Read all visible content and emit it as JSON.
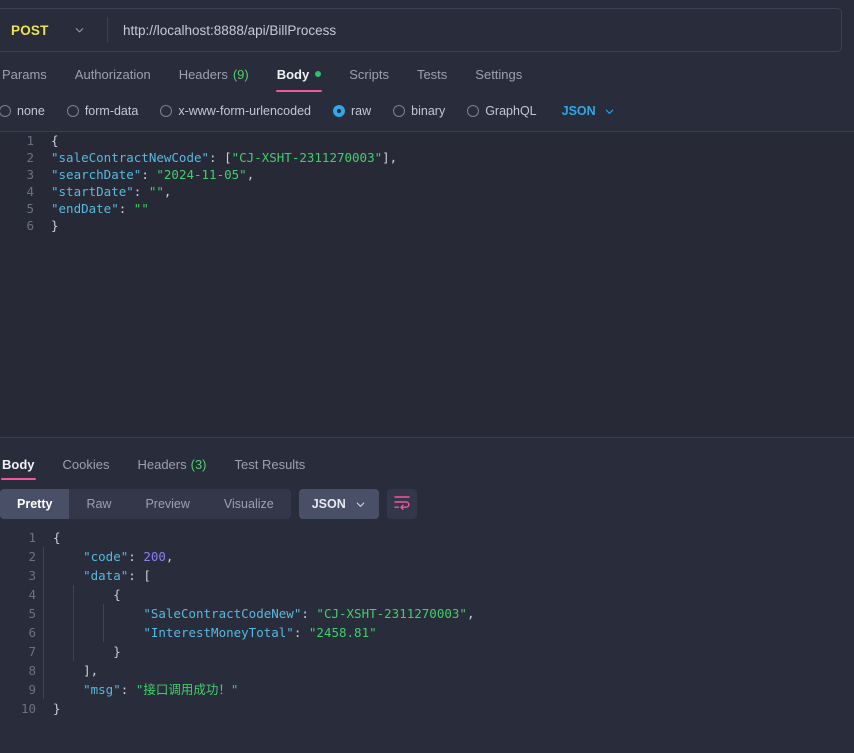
{
  "request": {
    "method": "POST",
    "method_caret_icon": "chevron-down-icon",
    "url": "http://localhost:8888/api/BillProcess",
    "tabs": [
      {
        "label": "Params",
        "active": false
      },
      {
        "label": "Authorization",
        "active": false
      },
      {
        "label": "Headers",
        "count": "(9)",
        "active": false
      },
      {
        "label": "Body",
        "active": true,
        "dot": true
      },
      {
        "label": "Scripts",
        "active": false
      },
      {
        "label": "Tests",
        "active": false
      },
      {
        "label": "Settings",
        "active": false
      }
    ],
    "body_types": [
      {
        "label": "none",
        "selected": false
      },
      {
        "label": "form-data",
        "selected": false
      },
      {
        "label": "x-www-form-urlencoded",
        "selected": false
      },
      {
        "label": "raw",
        "selected": true
      },
      {
        "label": "binary",
        "selected": false
      },
      {
        "label": "GraphQL",
        "selected": false
      }
    ],
    "format": "JSON",
    "format_caret_icon": "chevron-down-icon",
    "body_lines": [
      {
        "no": "1",
        "tokens": [
          {
            "t": "{",
            "c": "p"
          }
        ]
      },
      {
        "no": "2",
        "tokens": [
          {
            "t": "\"saleContractNewCode\"",
            "c": "k"
          },
          {
            "t": ": [",
            "c": "p"
          },
          {
            "t": "\"CJ-XSHT-2311270003\"",
            "c": "s"
          },
          {
            "t": "],",
            "c": "p"
          }
        ]
      },
      {
        "no": "3",
        "tokens": [
          {
            "t": "\"searchDate\"",
            "c": "k"
          },
          {
            "t": ": ",
            "c": "p"
          },
          {
            "t": "\"2024-11-05\"",
            "c": "s"
          },
          {
            "t": ",",
            "c": "p"
          }
        ]
      },
      {
        "no": "4",
        "tokens": [
          {
            "t": "\"startDate\"",
            "c": "k"
          },
          {
            "t": ": ",
            "c": "p"
          },
          {
            "t": "\"\"",
            "c": "s"
          },
          {
            "t": ",",
            "c": "p"
          }
        ]
      },
      {
        "no": "5",
        "tokens": [
          {
            "t": "\"endDate\"",
            "c": "k"
          },
          {
            "t": ": ",
            "c": "p"
          },
          {
            "t": "\"\"",
            "c": "s"
          }
        ]
      },
      {
        "no": "6",
        "tokens": [
          {
            "t": "}",
            "c": "p"
          }
        ]
      }
    ]
  },
  "response": {
    "tabs": [
      {
        "label": "Body",
        "active": true
      },
      {
        "label": "Cookies",
        "active": false
      },
      {
        "label": "Headers",
        "count": "(3)",
        "active": false
      },
      {
        "label": "Test Results",
        "active": false
      }
    ],
    "view_modes": [
      {
        "label": "Pretty",
        "active": true
      },
      {
        "label": "Raw",
        "active": false
      },
      {
        "label": "Preview",
        "active": false
      },
      {
        "label": "Visualize",
        "active": false
      }
    ],
    "format": "JSON",
    "format_caret_icon": "chevron-down-icon",
    "wrap_icon": "word-wrap-icon",
    "body_lines": [
      {
        "no": "1",
        "indent": 0,
        "tokens": [
          {
            "t": "{",
            "c": "p"
          }
        ]
      },
      {
        "no": "2",
        "indent": 4,
        "tokens": [
          {
            "t": "\"code\"",
            "c": "k"
          },
          {
            "t": ": ",
            "c": "p"
          },
          {
            "t": "200",
            "c": "n"
          },
          {
            "t": ",",
            "c": "p"
          }
        ]
      },
      {
        "no": "3",
        "indent": 4,
        "tokens": [
          {
            "t": "\"data\"",
            "c": "k"
          },
          {
            "t": ": [",
            "c": "p"
          }
        ]
      },
      {
        "no": "4",
        "indent": 8,
        "tokens": [
          {
            "t": "{",
            "c": "p"
          }
        ]
      },
      {
        "no": "5",
        "indent": 12,
        "tokens": [
          {
            "t": "\"SaleContractCodeNew\"",
            "c": "k"
          },
          {
            "t": ": ",
            "c": "p"
          },
          {
            "t": "\"CJ-XSHT-2311270003\"",
            "c": "s"
          },
          {
            "t": ",",
            "c": "p"
          }
        ]
      },
      {
        "no": "6",
        "indent": 12,
        "tokens": [
          {
            "t": "\"InterestMoneyTotal\"",
            "c": "k"
          },
          {
            "t": ": ",
            "c": "p"
          },
          {
            "t": "\"2458.81\"",
            "c": "s"
          }
        ]
      },
      {
        "no": "7",
        "indent": 8,
        "tokens": [
          {
            "t": "}",
            "c": "p"
          }
        ]
      },
      {
        "no": "8",
        "indent": 4,
        "tokens": [
          {
            "t": "],",
            "c": "p"
          }
        ]
      },
      {
        "no": "9",
        "indent": 4,
        "tokens": [
          {
            "t": "\"msg\"",
            "c": "k"
          },
          {
            "t": ": ",
            "c": "p"
          },
          {
            "t": "\"接口调用成功！\"",
            "c": "s"
          }
        ]
      },
      {
        "no": "10",
        "indent": 0,
        "tokens": [
          {
            "t": "}",
            "c": "p"
          }
        ]
      }
    ]
  },
  "colors": {
    "background": "#292c3a",
    "editor_background": "#272a36",
    "accent_pink": "#f0589b",
    "accent_blue": "#2ea8e8",
    "method_yellow": "#ece44d",
    "string_green": "#3fcf6a",
    "key_blue": "#57b8e0",
    "number_purple": "#8b7ff0"
  }
}
